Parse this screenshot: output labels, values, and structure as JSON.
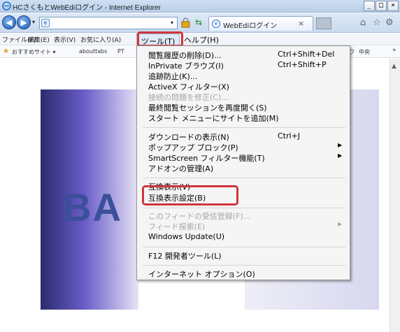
{
  "window": {
    "title": "HCさくもとWebEdiログイン - Internet Explorer",
    "minimize": "_",
    "maximize": "□",
    "close": "×"
  },
  "addressbar": {
    "back_icon": "arrow-left-icon",
    "forward_icon": "arrow-right-icon",
    "url": "",
    "dropdown": "▾",
    "tab_label": "WebEdiログイン",
    "tab_close": "×"
  },
  "menubar": {
    "items": [
      "ファイル(F)",
      "編集(E)",
      "表示(V)",
      "お気に入り(A)",
      "ツール(T)",
      "ヘルプ(H)"
    ]
  },
  "favorites": {
    "items": [
      "おすすめサイト ▾",
      "abouttabs",
      "PT",
      "ワ",
      "中央"
    ],
    "more": "»"
  },
  "content": {
    "banner_text": "BA"
  },
  "tools_menu": {
    "items": [
      {
        "label": "閲覧履歴の削除(D)...",
        "shortcut": "Ctrl+Shift+Del",
        "disabled": false
      },
      {
        "label": "InPrivate ブラウズ(I)",
        "shortcut": "Ctrl+Shift+P",
        "disabled": false
      },
      {
        "label": "追跡防止(K)...",
        "shortcut": "",
        "disabled": false
      },
      {
        "label": "ActiveX フィルター(X)",
        "shortcut": "",
        "disabled": false
      },
      {
        "label": "接続の問題を修正(C)...",
        "shortcut": "",
        "disabled": true
      },
      {
        "label": "最終閲覧セッションを再度開く(S)",
        "shortcut": "",
        "disabled": false
      },
      {
        "label": "スタート メニューにサイトを追加(M)",
        "shortcut": "",
        "disabled": false
      },
      {
        "label": "ダウンロードの表示(N)",
        "shortcut": "Ctrl+J",
        "disabled": false
      },
      {
        "label": "ポップアップ ブロック(P)",
        "shortcut": "",
        "disabled": false
      },
      {
        "label": "SmartScreen フィルター機能(T)",
        "shortcut": "",
        "disabled": false
      },
      {
        "label": "アドオンの管理(A)",
        "shortcut": "",
        "disabled": false
      },
      {
        "label": "互換表示(V)",
        "shortcut": "",
        "disabled": false
      },
      {
        "label": "互換表示設定(B)",
        "shortcut": "",
        "disabled": false
      },
      {
        "label": "このフィードの受信登録(F)...",
        "shortcut": "",
        "disabled": true
      },
      {
        "label": "フィード探索(E)",
        "shortcut": "",
        "disabled": true
      },
      {
        "label": "Windows Update(U)",
        "shortcut": "",
        "disabled": false
      },
      {
        "label": "F12 開発者ツール(L)",
        "shortcut": "",
        "disabled": false
      },
      {
        "label": "インターネット オプション(O)",
        "shortcut": "",
        "disabled": false
      }
    ],
    "submenu_arrow": "▶"
  },
  "colors": {
    "highlight": "#d1353b",
    "menu_bg": "#f5f5f5",
    "disabled_text": "#a5a5a5"
  }
}
